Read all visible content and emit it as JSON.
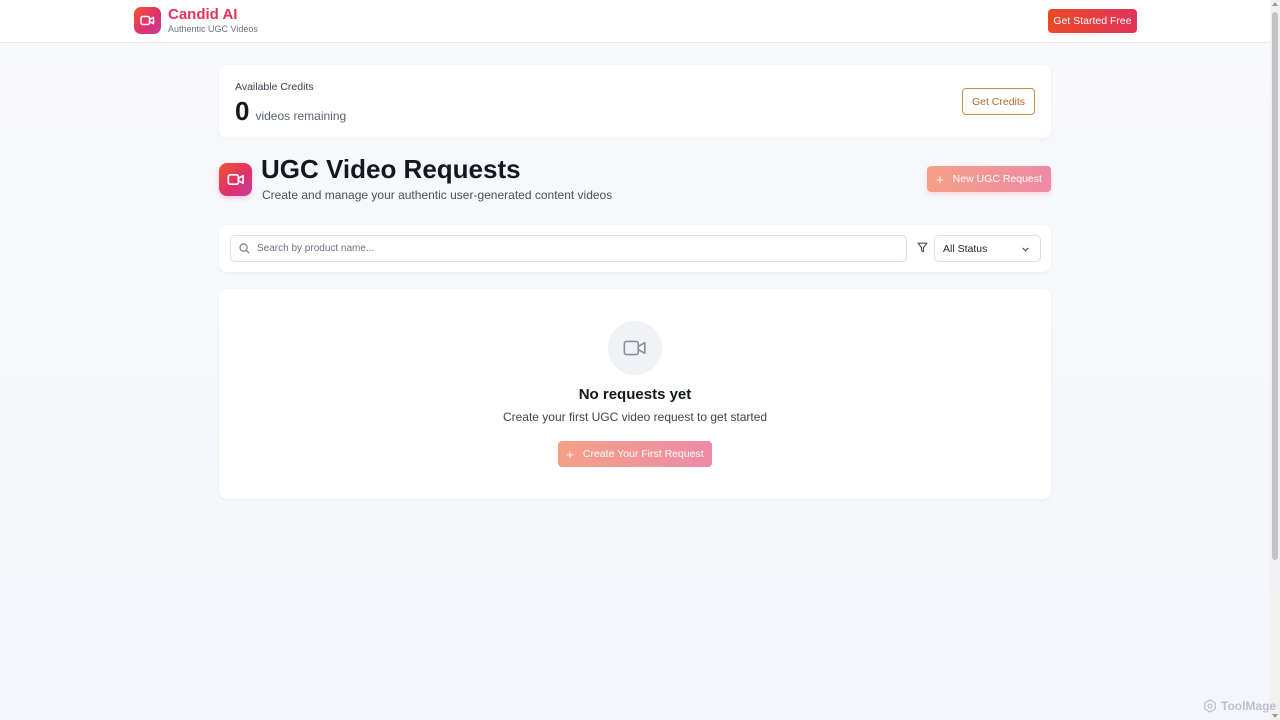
{
  "nav": {
    "brand_name": "Candid AI",
    "brand_tagline": "Authentic UGC Videos",
    "cta_label": "Get Started Free"
  },
  "credits": {
    "label": "Available Credits",
    "count": "0",
    "unit": "videos remaining",
    "button_label": "Get Credits"
  },
  "page": {
    "title": "UGC Video Requests",
    "subtitle": "Create and manage your authentic user-generated content videos",
    "new_button_icon": "+",
    "new_button_label": "New UGC Request"
  },
  "filters": {
    "search_placeholder": "Search by product name...",
    "search_value": "",
    "status_selected": "All Status"
  },
  "empty_state": {
    "title": "No requests yet",
    "subtitle": "Create your first UGC video request to get started",
    "button_icon": "+",
    "button_label": "Create Your First Request"
  },
  "watermark": {
    "text": "ToolMage"
  },
  "icons": {
    "brand_logo": "video-camera-icon",
    "search": "search-icon",
    "filter": "filter-icon",
    "dropdown": "chevron-down-icon",
    "empty": "video-camera-icon"
  },
  "colors": {
    "brand": "#e3315b",
    "accent_gradient_start": "#ea4a26",
    "accent_gradient_end": "#e2325a",
    "credits_button": "#b46a2a",
    "muted_button_start": "#f4a086",
    "muted_button_end": "#ee8aa6"
  }
}
